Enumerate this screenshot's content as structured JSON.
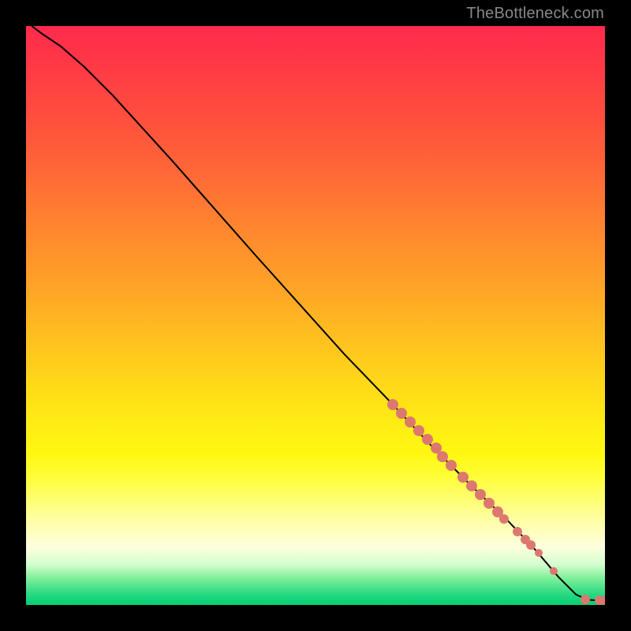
{
  "watermark": "TheBottleneck.com",
  "chart_data": {
    "type": "line",
    "title": "",
    "xlabel": "",
    "ylabel": "",
    "xlim": [
      0,
      100
    ],
    "ylim": [
      0,
      100
    ],
    "gradient_stops": [
      {
        "pct": 0,
        "color": "#ff2a4d"
      },
      {
        "pct": 50,
        "color": "#ffd020"
      },
      {
        "pct": 80,
        "color": "#feff90"
      },
      {
        "pct": 100,
        "color": "#06cf75"
      }
    ],
    "curve": [
      {
        "x": 1.0,
        "y": 100.0
      },
      {
        "x": 3.0,
        "y": 98.5
      },
      {
        "x": 6.0,
        "y": 96.5
      },
      {
        "x": 10.0,
        "y": 93.0
      },
      {
        "x": 15.0,
        "y": 88.0
      },
      {
        "x": 25.0,
        "y": 77.0
      },
      {
        "x": 40.0,
        "y": 60.0
      },
      {
        "x": 55.0,
        "y": 43.3
      },
      {
        "x": 63.0,
        "y": 35.0
      },
      {
        "x": 70.0,
        "y": 27.5
      },
      {
        "x": 77.0,
        "y": 20.5
      },
      {
        "x": 83.0,
        "y": 14.8
      },
      {
        "x": 88.0,
        "y": 9.5
      },
      {
        "x": 92.0,
        "y": 4.8
      },
      {
        "x": 95.0,
        "y": 1.8
      },
      {
        "x": 97.0,
        "y": 0.9
      },
      {
        "x": 98.5,
        "y": 0.8
      },
      {
        "x": 100.0,
        "y": 0.8
      }
    ],
    "points": [
      {
        "x": 63.4,
        "y": 34.6,
        "r": 7
      },
      {
        "x": 64.9,
        "y": 33.1,
        "r": 7
      },
      {
        "x": 66.4,
        "y": 31.6,
        "r": 7
      },
      {
        "x": 67.9,
        "y": 30.1,
        "r": 7
      },
      {
        "x": 69.4,
        "y": 28.6,
        "r": 7
      },
      {
        "x": 70.9,
        "y": 27.1,
        "r": 7
      },
      {
        "x": 72.0,
        "y": 25.6,
        "r": 7
      },
      {
        "x": 73.5,
        "y": 24.1,
        "r": 7
      },
      {
        "x": 75.5,
        "y": 22.1,
        "r": 7
      },
      {
        "x": 77.0,
        "y": 20.6,
        "r": 7
      },
      {
        "x": 78.5,
        "y": 19.1,
        "r": 7
      },
      {
        "x": 80.0,
        "y": 17.6,
        "r": 7
      },
      {
        "x": 81.5,
        "y": 16.1,
        "r": 7
      },
      {
        "x": 82.5,
        "y": 14.9,
        "r": 6
      },
      {
        "x": 84.9,
        "y": 12.7,
        "r": 6
      },
      {
        "x": 86.2,
        "y": 11.3,
        "r": 6
      },
      {
        "x": 87.2,
        "y": 10.3,
        "r": 6
      },
      {
        "x": 88.6,
        "y": 9.0,
        "r": 5
      },
      {
        "x": 91.2,
        "y": 5.9,
        "r": 5
      },
      {
        "x": 96.6,
        "y": 0.9,
        "r": 6
      },
      {
        "x": 99.1,
        "y": 0.8,
        "r": 6
      },
      {
        "x": 100.0,
        "y": 0.8,
        "r": 6
      }
    ]
  }
}
